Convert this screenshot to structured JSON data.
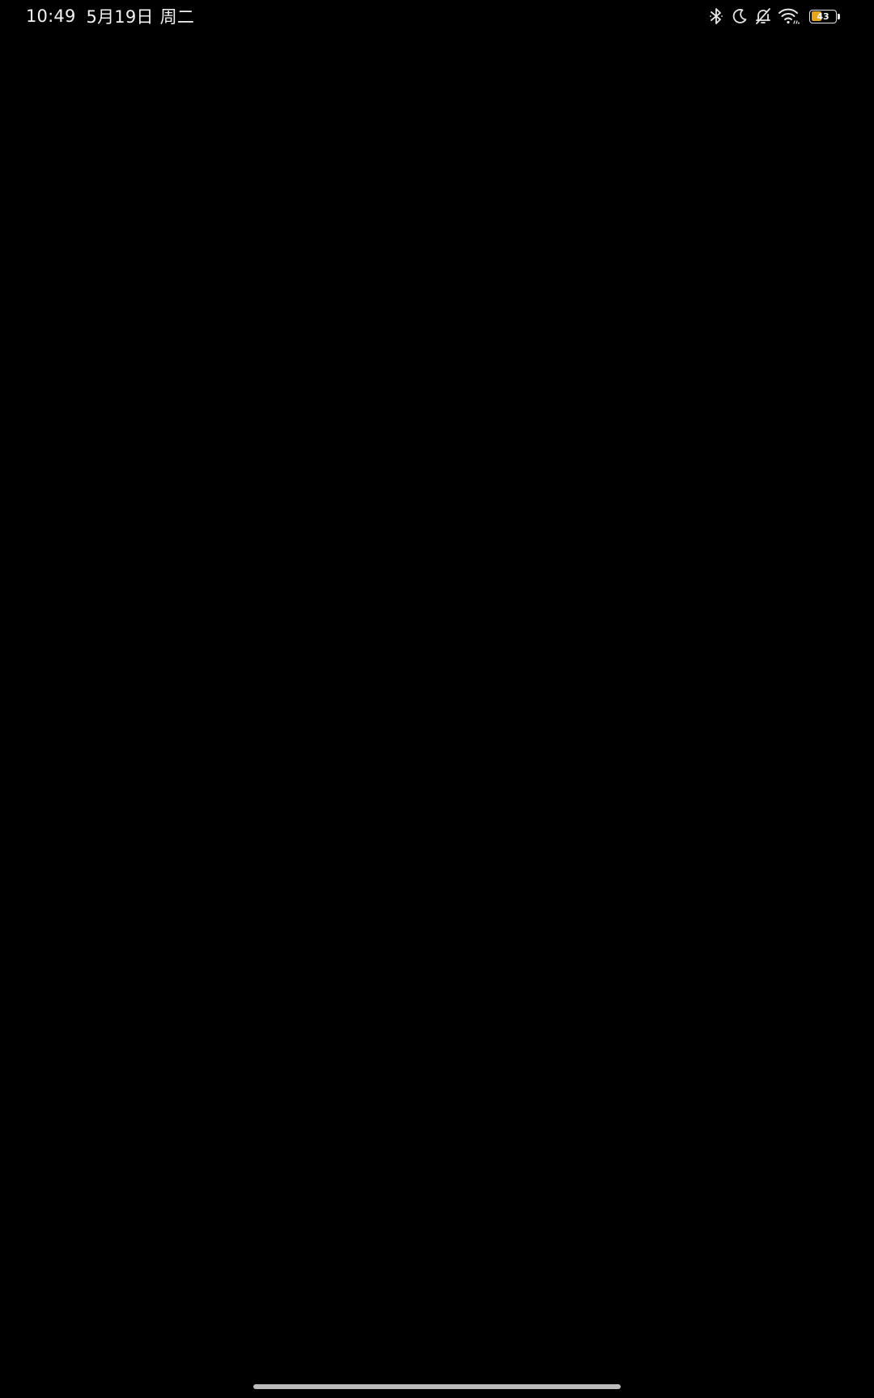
{
  "status_bar": {
    "time": "10:49",
    "date": "5月19日",
    "weekday": "周二",
    "icons": [
      "bluetooth-icon",
      "do-not-disturb-moon-icon",
      "silent-bell-off-icon",
      "wifi-icon"
    ],
    "battery": {
      "level_percent": 43,
      "label": "43",
      "fill_color": "#e8a316"
    }
  },
  "screen": {
    "background_color": "#000000"
  },
  "navigation": {
    "home_indicator_color": "#bdbdbd"
  }
}
